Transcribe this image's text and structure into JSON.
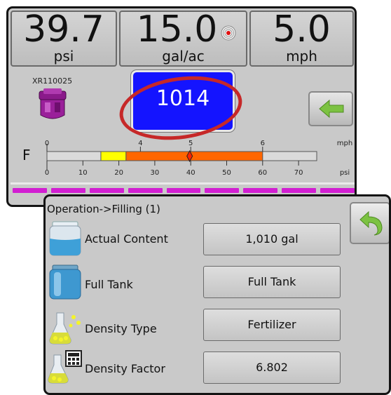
{
  "readouts": {
    "pressure": {
      "value": "39.7",
      "unit": "psi"
    },
    "rate": {
      "value": "15.0",
      "unit": "gal/ac"
    },
    "speed": {
      "value": "5.0",
      "unit": "mph"
    }
  },
  "nozzle": {
    "label": "XR110025"
  },
  "counter": {
    "value": "1014"
  },
  "gauge": {
    "label": "F",
    "mph_ticks": [
      "0",
      "4",
      "5",
      "6"
    ],
    "mph_unit": "mph",
    "psi_ticks": [
      "0",
      "10",
      "20",
      "30",
      "40",
      "50",
      "60",
      "70"
    ],
    "psi_unit": "psi",
    "psi_min": 0,
    "psi_max": 75,
    "yellow_range_psi": [
      15,
      22
    ],
    "orange_range_psi": [
      22,
      60
    ],
    "current_psi": 39.7,
    "colors": {
      "yellow": "#ffff00",
      "orange": "#ff6600",
      "marker": "#ff2200"
    }
  },
  "sections": {
    "count": 9,
    "color": "#d21ed2"
  },
  "filling": {
    "title": "Operation->Filling (1)",
    "rows": [
      {
        "icon": "tank-icon",
        "label": "Actual Content",
        "value": "1,010 gal"
      },
      {
        "icon": "full-tank-icon",
        "label": "Full Tank",
        "value": "Full Tank"
      },
      {
        "icon": "flask-icon",
        "label": "Density Type",
        "value": "Fertilizer"
      },
      {
        "icon": "flask-calculator-icon",
        "label": "Density Factor",
        "value": "6.802"
      }
    ]
  }
}
